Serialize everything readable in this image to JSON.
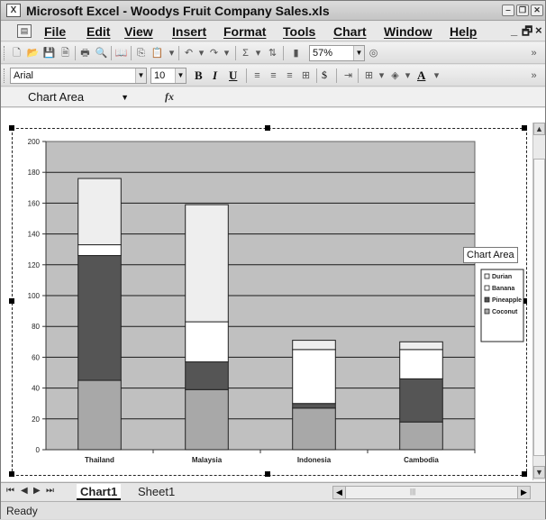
{
  "window": {
    "title": "Microsoft Excel - Woodys Fruit Company Sales.xls",
    "minimize_icon": "minimize-icon",
    "restore_icon": "restore-icon",
    "close_icon": "close-icon"
  },
  "menubar": {
    "items": [
      "File",
      "Edit",
      "View",
      "Insert",
      "Format",
      "Tools",
      "Chart",
      "Window",
      "Help"
    ],
    "doc_min": "_",
    "doc_restore": "🗗",
    "doc_close": "×"
  },
  "toolbar": {
    "zoom": "57%"
  },
  "format_toolbar": {
    "font_name": "Arial",
    "font_size": "10",
    "bold": "B",
    "italic": "I",
    "underline": "U",
    "currency": "$",
    "font_color_label": "A"
  },
  "formula_bar": {
    "name_box": "Chart Area",
    "fx_label": "fx"
  },
  "tooltip": {
    "text": "Chart Area"
  },
  "chart_data": {
    "type": "bar",
    "stacked": true,
    "categories": [
      "Thailand",
      "Malaysia",
      "Indonesia",
      "Cambodia"
    ],
    "series": [
      {
        "name": "Coconut",
        "values": [
          45,
          39,
          27,
          18
        ],
        "color": "#a8a8a8"
      },
      {
        "name": "Pineapple",
        "values": [
          81,
          18,
          3,
          28
        ],
        "color": "#555555"
      },
      {
        "name": "Banana",
        "values": [
          7,
          26,
          35,
          19
        ],
        "color": "#ffffff"
      },
      {
        "name": "Durian",
        "values": [
          43,
          76,
          6,
          5
        ],
        "color": "#eeeeee"
      }
    ],
    "legend_entries": [
      "Durian",
      "Banana",
      "Pineapple",
      "Coconut"
    ],
    "y_ticks": [
      "0",
      "20",
      "40",
      "60",
      "80",
      "100",
      "120",
      "140",
      "160",
      "180",
      "200"
    ],
    "ylim": [
      0,
      200
    ],
    "grid": true,
    "legend_position": "right",
    "plot_background": "#c0c0c0"
  },
  "sheet_tabs": {
    "tabs": [
      "Chart1",
      "Sheet1"
    ],
    "active": "Chart1"
  },
  "status": {
    "text": "Ready"
  }
}
